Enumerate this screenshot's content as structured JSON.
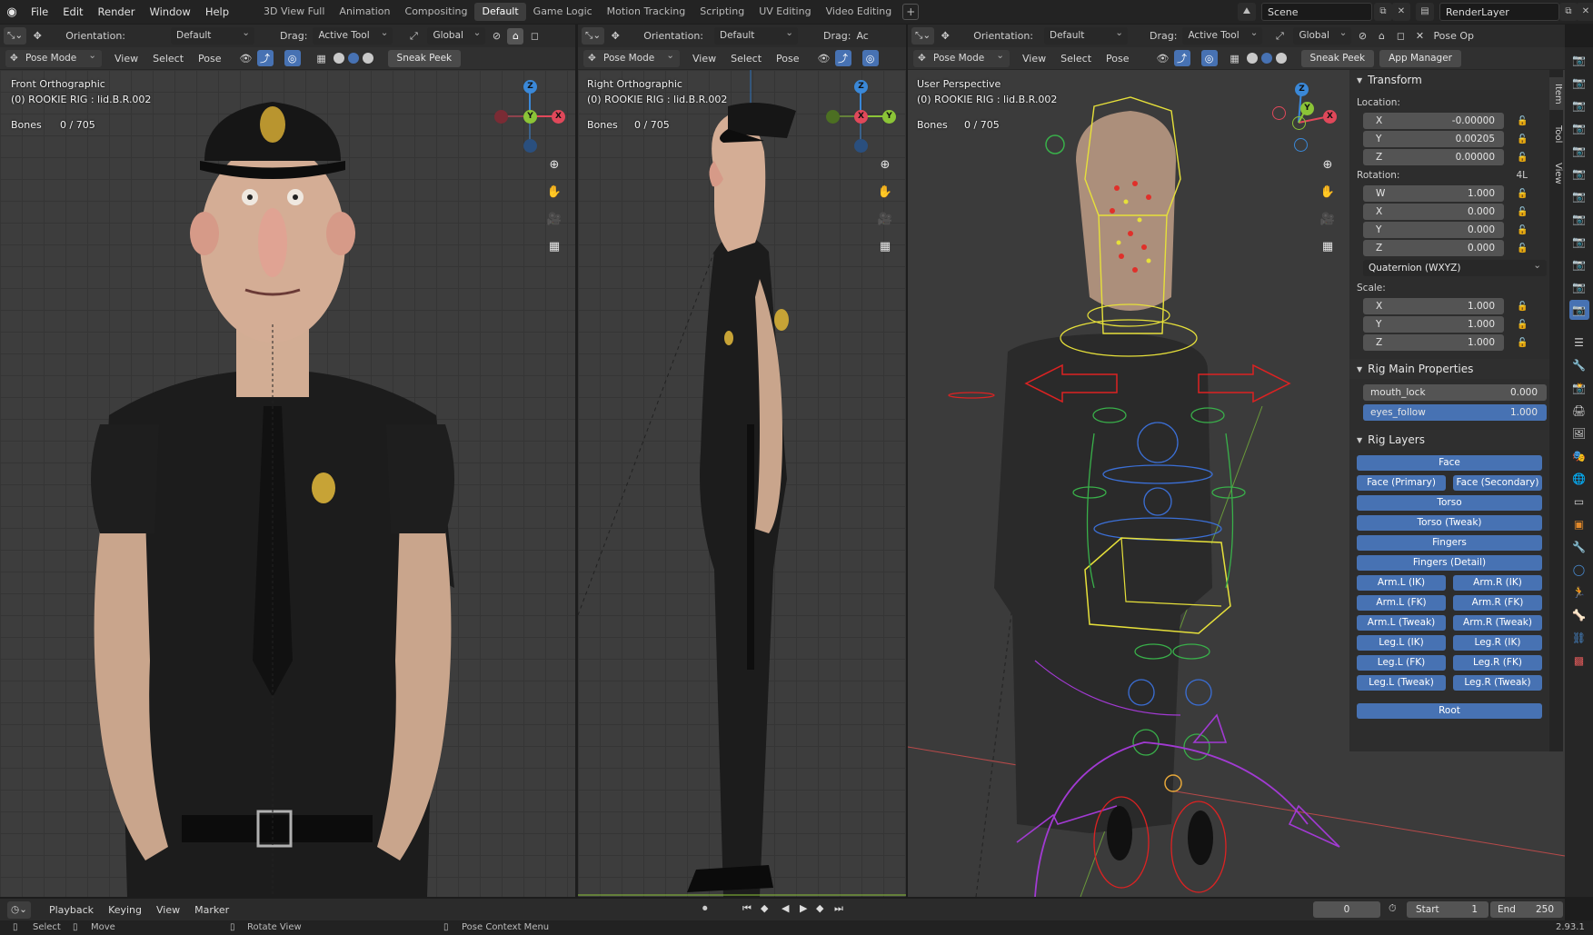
{
  "menubar": {
    "items": [
      "File",
      "Edit",
      "Render",
      "Window",
      "Help"
    ],
    "workspaces": [
      "3D View Full",
      "Animation",
      "Compositing",
      "Default",
      "Game Logic",
      "Motion Tracking",
      "Scripting",
      "UV Editing",
      "Video Editing"
    ],
    "active_workspace": "Default",
    "scene_name": "Scene",
    "render_layer": "RenderLayer"
  },
  "viewports": [
    {
      "orientation_label": "Orientation:",
      "orientation_value": "Default",
      "drag_label": "Drag:",
      "drag_value": "Active Tool",
      "transform_space": "Global",
      "mode": "Pose Mode",
      "menus": [
        "View",
        "Select",
        "Pose"
      ],
      "sneak_peek": "Sneak Peek",
      "view_name": "Front Orthographic",
      "object_info": "(0) ROOKIE RIG : lid.B.R.002",
      "bones_label": "Bones",
      "bones_value": "0 / 705"
    },
    {
      "orientation_label": "Orientation:",
      "orientation_value": "Default",
      "drag_label": "Drag:",
      "drag_value": "Ac",
      "mode": "Pose Mode",
      "menus": [
        "View",
        "Select",
        "Pose"
      ],
      "view_name": "Right Orthographic",
      "object_info": "(0) ROOKIE RIG : lid.B.R.002",
      "bones_label": "Bones",
      "bones_value": "0 / 705"
    },
    {
      "orientation_label": "Orientation:",
      "orientation_value": "Default",
      "drag_label": "Drag:",
      "drag_value": "Active Tool",
      "transform_space": "Global",
      "mode": "Pose Mode",
      "menus": [
        "View",
        "Select",
        "Pose"
      ],
      "sneak_peek": "Sneak Peek",
      "app_manager": "App Manager",
      "header_extra": "Pose Op",
      "view_name": "User Perspective",
      "object_info": "(0) ROOKIE RIG : lid.B.R.002",
      "bones_label": "Bones",
      "bones_value": "0 / 705"
    }
  ],
  "gizmo": {
    "x": "X",
    "y": "Y",
    "z": "Z",
    "x_color": "#e0485a",
    "y_color": "#8bc437",
    "z_color": "#3a88d8"
  },
  "sidebar": {
    "tabs": [
      "Item",
      "Tool",
      "View"
    ],
    "transform": {
      "title": "Transform",
      "location_label": "Location:",
      "location": [
        {
          "axis": "X",
          "value": "-0.00000"
        },
        {
          "axis": "Y",
          "value": "0.00205"
        },
        {
          "axis": "Z",
          "value": "0.00000"
        }
      ],
      "rotation_label": "Rotation:",
      "rotation_mode_short": "4L",
      "rotation": [
        {
          "axis": "W",
          "value": "1.000"
        },
        {
          "axis": "X",
          "value": "0.000"
        },
        {
          "axis": "Y",
          "value": "0.000"
        },
        {
          "axis": "Z",
          "value": "0.000"
        }
      ],
      "rotation_mode": "Quaternion (WXYZ)",
      "scale_label": "Scale:",
      "scale": [
        {
          "axis": "X",
          "value": "1.000"
        },
        {
          "axis": "Y",
          "value": "1.000"
        },
        {
          "axis": "Z",
          "value": "1.000"
        }
      ]
    },
    "rig_main": {
      "title": "Rig Main Properties",
      "props": [
        {
          "name": "mouth_lock",
          "value": "0.000",
          "fill": 0.0
        },
        {
          "name": "eyes_follow",
          "value": "1.000",
          "fill": 1.0
        }
      ]
    },
    "rig_layers": {
      "title": "Rig Layers",
      "face": "Face",
      "face_primary": "Face (Primary)",
      "face_secondary": "Face (Secondary)",
      "torso": "Torso",
      "torso_tweak": "Torso (Tweak)",
      "fingers": "Fingers",
      "fingers_detail": "Fingers (Detail)",
      "pairs": [
        [
          "Arm.L (IK)",
          "Arm.R (IK)"
        ],
        [
          "Arm.L (FK)",
          "Arm.R (FK)"
        ],
        [
          "Arm.L (Tweak)",
          "Arm.R (Tweak)"
        ],
        [
          "Leg.L (IK)",
          "Leg.R (IK)"
        ],
        [
          "Leg.L (FK)",
          "Leg.R (FK)"
        ],
        [
          "Leg.L (Tweak)",
          "Leg.R (Tweak)"
        ]
      ],
      "root": "Root"
    }
  },
  "timeline": {
    "menus": [
      "Playback",
      "Keying",
      "View",
      "Marker"
    ],
    "current_frame": "0",
    "start_label": "Start",
    "start_value": "1",
    "end_label": "End",
    "end_value": "250"
  },
  "statusbar": {
    "select": "Select",
    "move": "Move",
    "rotate_view": "Rotate View",
    "context_menu": "Pose Context Menu",
    "version": "2.93.1"
  }
}
